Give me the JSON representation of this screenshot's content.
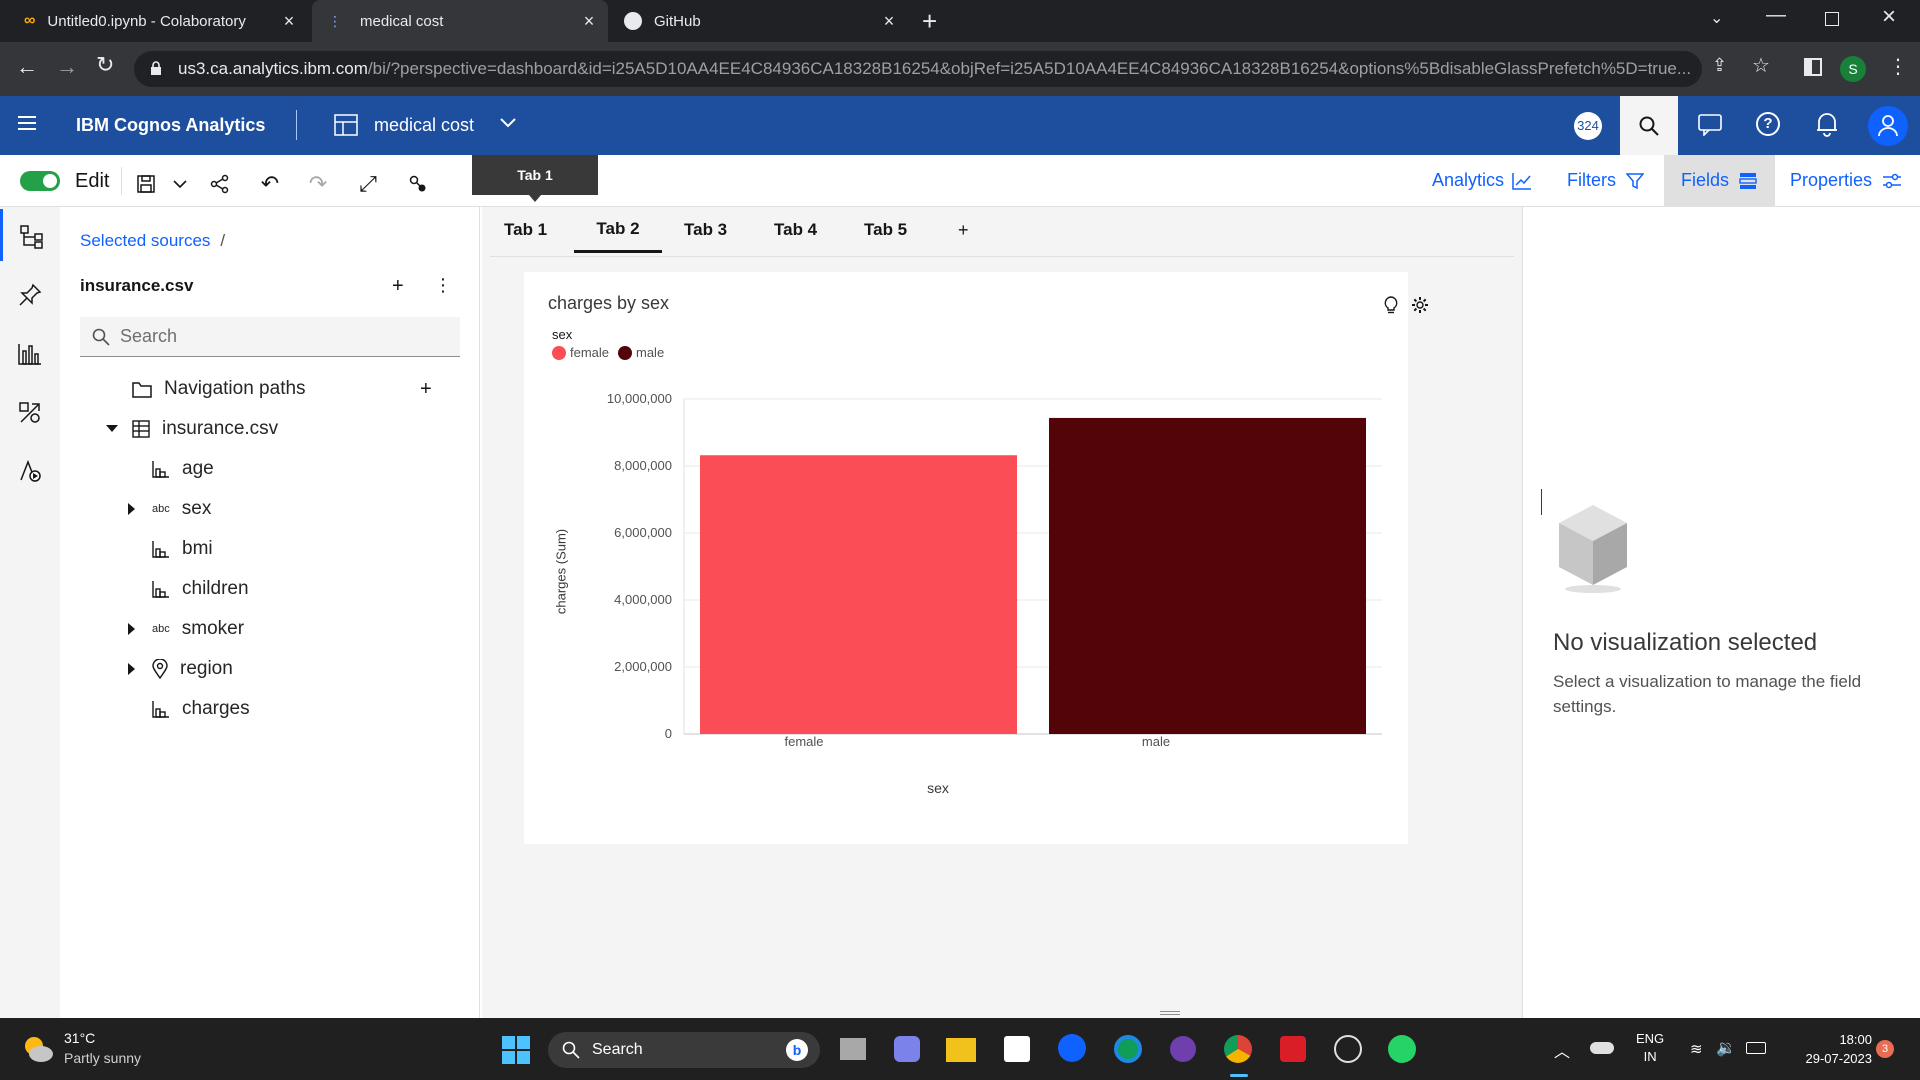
{
  "browser": {
    "tabs": [
      {
        "title": "Untitled0.ipynb - Colaboratory",
        "icon": "colab-icon"
      },
      {
        "title": "medical cost",
        "icon": "cognos-icon"
      },
      {
        "title": "GitHub",
        "icon": "github-icon"
      }
    ],
    "url_host": "us3.ca.analytics.ibm.com",
    "url_path": "/bi/?perspective=dashboard&id=i25A5D10AA4EE4C84936CA18328B16254&objRef=i25A5D10AA4EE4C84936CA18328B16254&options%5BdisableGlassPrefetch%5D=true...",
    "profile_initial": "S"
  },
  "app": {
    "product": "IBM Cognos Analytics",
    "dashboard_name": "medical cost",
    "notification_count": "324"
  },
  "toolbar": {
    "edit_label": "Edit",
    "tooltip": "Tab 1",
    "analytics_label": "Analytics",
    "filters_label": "Filters",
    "fields_label": "Fields",
    "properties_label": "Properties"
  },
  "sources": {
    "breadcrumb": "Selected sources",
    "separator": "/",
    "file": "insurance.csv",
    "search_placeholder": "Search",
    "nav_paths": "Navigation paths",
    "table": "insurance.csv",
    "fields": [
      {
        "name": "age",
        "type": "measure",
        "expandable": false
      },
      {
        "name": "sex",
        "type": "abc",
        "expandable": true
      },
      {
        "name": "bmi",
        "type": "measure",
        "expandable": false
      },
      {
        "name": "children",
        "type": "measure",
        "expandable": false
      },
      {
        "name": "smoker",
        "type": "abc",
        "expandable": true
      },
      {
        "name": "region",
        "type": "geo",
        "expandable": true
      },
      {
        "name": "charges",
        "type": "measure",
        "expandable": false
      }
    ],
    "type_abc": "abc"
  },
  "dashboard_tabs": [
    "Tab 1",
    "Tab 2",
    "Tab 3",
    "Tab 4",
    "Tab 5"
  ],
  "active_tab": 1,
  "add_tab": "+",
  "widget": {
    "title": "charges by sex",
    "legend_title": "sex"
  },
  "chart_data": {
    "type": "bar",
    "title": "charges by sex",
    "categories": [
      "female",
      "male"
    ],
    "values": [
      8321061,
      9434764
    ],
    "colors": [
      "#fa4d56",
      "#520408"
    ],
    "xlabel": "sex",
    "ylabel": "charges (Sum)",
    "ylim": [
      0,
      10000000
    ],
    "yticks": [
      "0",
      "2,000,000",
      "4,000,000",
      "6,000,000",
      "8,000,000",
      "10,000,000"
    ],
    "legend": [
      "female",
      "male"
    ],
    "legend_title": "sex",
    "legend_position": "top-left",
    "grid": true
  },
  "right_panel": {
    "title": "No visualization selected",
    "message": "Select a visualization to manage the field settings."
  },
  "taskbar": {
    "temp": "31°C",
    "weather": "Partly sunny",
    "search": "Search",
    "lang1": "ENG",
    "lang2": "IN",
    "time": "18:00",
    "date": "29-07-2023",
    "badge": "3"
  },
  "colors": {
    "brand_blue": "#1d4f9e",
    "link_blue": "#0f62fe",
    "toggle_green": "#24a148"
  }
}
